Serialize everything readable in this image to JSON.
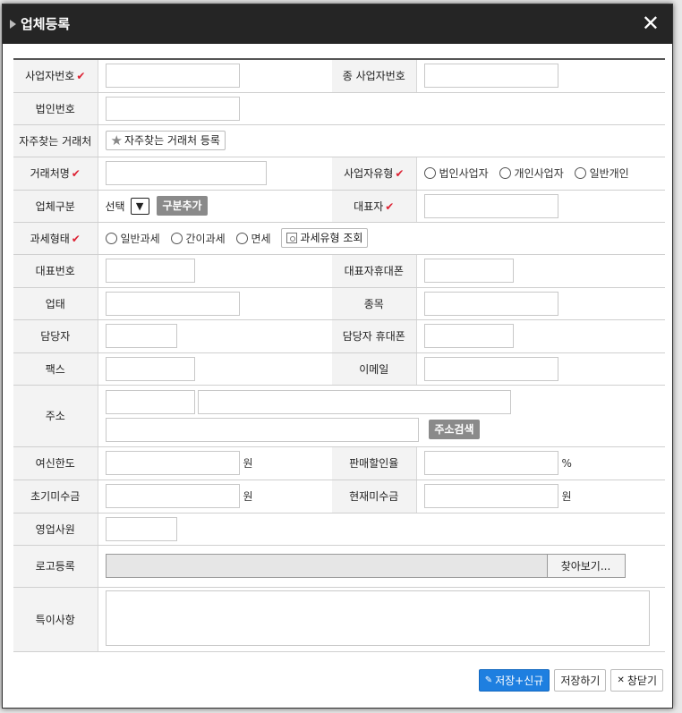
{
  "dialog": {
    "title": "업체등록",
    "close_symbol": "✕"
  },
  "fields": {
    "bizno_label": "사업자번호",
    "sub_bizno_label": "종 사업자번호",
    "corpno_label": "법인번호",
    "freq_label": "자주찾는 거래처",
    "freq_button": "자주찾는 거래처 등록",
    "name_label": "거래처명",
    "biztype_label": "사업자유형",
    "biztype_options": [
      "법인사업자",
      "개인사업자",
      "일반개인"
    ],
    "category_label": "업체구분",
    "category_select": "선택",
    "category_add_button": "구분추가",
    "ceo_label": "대표자",
    "tax_label": "과세형태",
    "tax_options": [
      "일반과세",
      "간이과세",
      "면세"
    ],
    "tax_lookup_button": "과세유형 조회",
    "phone_label": "대표번호",
    "ceo_mobile_label": "대표자휴대폰",
    "biz_cond_label": "업태",
    "biz_item_label": "종목",
    "manager_label": "담당자",
    "manager_mobile_label": "담당자 휴대폰",
    "fax_label": "팩스",
    "email_label": "이메일",
    "address_label": "주소",
    "address_search_button": "주소검색",
    "credit_label": "여신한도",
    "credit_unit": "원",
    "discount_label": "판매할인율",
    "discount_unit": "%",
    "init_ar_label": "초기미수금",
    "init_ar_unit": "원",
    "cur_ar_label": "현재미수금",
    "cur_ar_unit": "원",
    "sales_rep_label": "영업사원",
    "logo_label": "로고등록",
    "logo_browse_button": "찾아보기...",
    "memo_label": "특이사항"
  },
  "footer": {
    "save_new": "저장+신규",
    "save": "저장하기",
    "close": "창닫기"
  },
  "colors": {
    "titlebar": "#252525",
    "primary_button": "#1e7fe0",
    "required_check": "#d23",
    "label_bg": "#f3f3f3"
  },
  "icons": {
    "required": "check-icon",
    "favorite": "star-icon",
    "lookup": "search-icon",
    "close": "close-icon"
  }
}
